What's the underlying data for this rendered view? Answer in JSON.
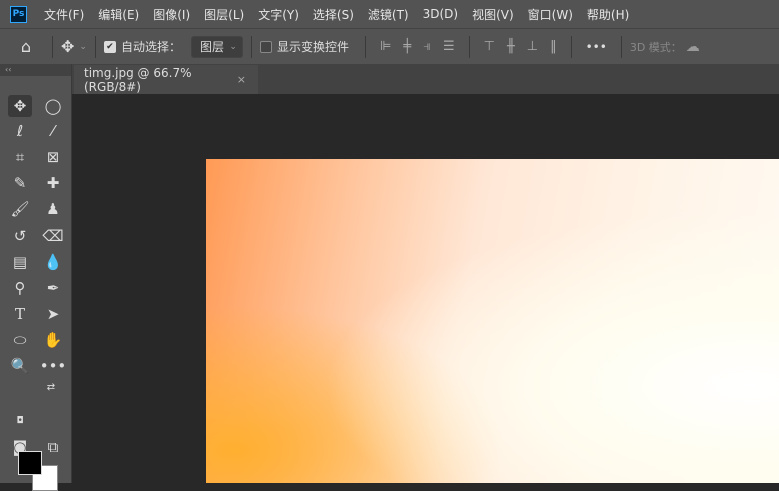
{
  "app": {
    "logo": "Ps"
  },
  "menu": [
    "文件(F)",
    "编辑(E)",
    "图像(I)",
    "图层(L)",
    "文字(Y)",
    "选择(S)",
    "滤镜(T)",
    "3D(D)",
    "视图(V)",
    "窗口(W)",
    "帮助(H)"
  ],
  "options": {
    "auto_select_label": "自动选择：",
    "auto_select_checked": true,
    "layer_select": "图层",
    "show_transform_label": "显示变换控件",
    "show_transform_checked": false,
    "more": "•••",
    "mode_3d_label": "3D 模式："
  },
  "document_tab": {
    "title": "timg.jpg @ 66.7%(RGB/8#)",
    "close": "×"
  },
  "tools": {
    "panel_collapse": "‹‹"
  }
}
